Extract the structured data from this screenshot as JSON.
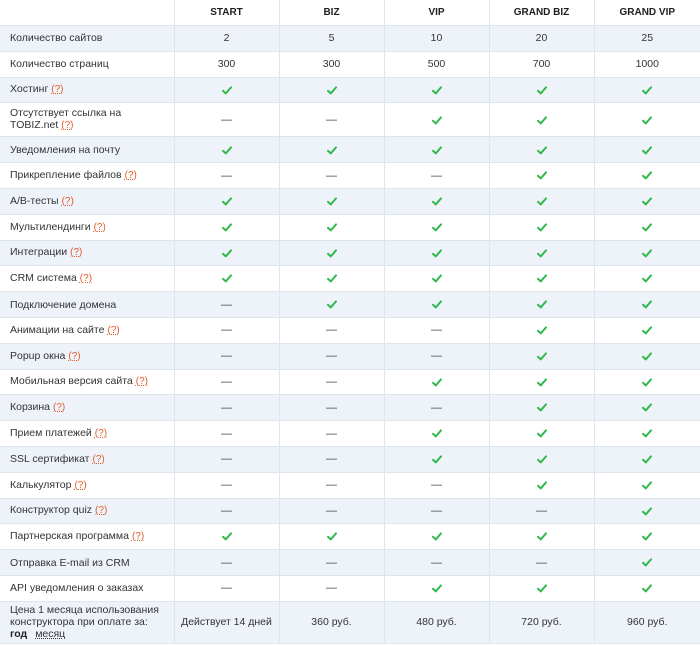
{
  "plans": [
    "START",
    "BIZ",
    "VIP",
    "GRAND BIZ",
    "GRAND VIP"
  ],
  "help_mark": "(?)",
  "colors": {
    "check": "#2fb84a",
    "help": "#e25d2b",
    "row_alt": "#eef3fa",
    "border": "#dfe5ec"
  },
  "rows": [
    {
      "label": "Количество сайтов",
      "help": false,
      "type": "text",
      "values": [
        "2",
        "5",
        "10",
        "20",
        "25"
      ]
    },
    {
      "label": "Количество страниц",
      "help": false,
      "type": "text",
      "values": [
        "300",
        "300",
        "500",
        "700",
        "1000"
      ]
    },
    {
      "label": "Хостинг",
      "help": true,
      "type": "bool",
      "values": [
        true,
        true,
        true,
        true,
        true
      ]
    },
    {
      "label": "Отсутствует ссылка на TOBIZ.net",
      "help": true,
      "type": "bool",
      "tall": true,
      "values": [
        false,
        false,
        true,
        true,
        true
      ]
    },
    {
      "label": "Уведомления на почту",
      "help": false,
      "type": "bool",
      "values": [
        true,
        true,
        true,
        true,
        true
      ]
    },
    {
      "label": "Прикрепление файлов",
      "help": true,
      "type": "bool",
      "values": [
        false,
        false,
        false,
        true,
        true
      ]
    },
    {
      "label": "A/B-тесты",
      "help": true,
      "type": "bool",
      "values": [
        true,
        true,
        true,
        true,
        true
      ]
    },
    {
      "label": "Мультилендинги",
      "help": true,
      "type": "bool",
      "values": [
        true,
        true,
        true,
        true,
        true
      ]
    },
    {
      "label": "Интеграции",
      "help": true,
      "type": "bool",
      "values": [
        true,
        true,
        true,
        true,
        true
      ]
    },
    {
      "label": "CRM система",
      "help": true,
      "type": "bool",
      "values": [
        true,
        true,
        true,
        true,
        true
      ]
    },
    {
      "label": "Подключение домена",
      "help": false,
      "type": "bool",
      "values": [
        false,
        true,
        true,
        true,
        true
      ]
    },
    {
      "label": "Анимации на сайте",
      "help": true,
      "type": "bool",
      "values": [
        false,
        false,
        false,
        true,
        true
      ]
    },
    {
      "label": "Popup окна",
      "help": true,
      "type": "bool",
      "values": [
        false,
        false,
        false,
        true,
        true
      ]
    },
    {
      "label": "Мобильная версия сайта",
      "help": true,
      "type": "bool",
      "values": [
        false,
        false,
        true,
        true,
        true
      ]
    },
    {
      "label": "Корзина",
      "help": true,
      "type": "bool",
      "values": [
        false,
        false,
        false,
        true,
        true
      ]
    },
    {
      "label": "Прием платежей",
      "help": true,
      "type": "bool",
      "values": [
        false,
        false,
        true,
        true,
        true
      ]
    },
    {
      "label": "SSL сертификат",
      "help": true,
      "type": "bool",
      "values": [
        false,
        false,
        true,
        true,
        true
      ]
    },
    {
      "label": "Калькулятор",
      "help": true,
      "type": "bool",
      "values": [
        false,
        false,
        false,
        true,
        true
      ]
    },
    {
      "label": "Конструктор quiz",
      "help": true,
      "type": "bool",
      "values": [
        false,
        false,
        false,
        false,
        true
      ]
    },
    {
      "label": "Партнерская программа",
      "help": true,
      "type": "bool",
      "values": [
        true,
        true,
        true,
        true,
        true
      ]
    },
    {
      "label": "Отправка E-mail из CRM",
      "help": false,
      "type": "bool",
      "values": [
        false,
        false,
        false,
        false,
        true
      ]
    },
    {
      "label": "API уведомления о заказах",
      "help": false,
      "type": "bool",
      "values": [
        false,
        false,
        true,
        true,
        true
      ]
    }
  ],
  "price_row": {
    "label": "Цена 1 месяца использования конструктора при оплате за:",
    "period_selected": "год",
    "period_other": "месяц",
    "values": [
      "Действует 14 дней",
      "360 руб.",
      "480 руб.",
      "720 руб.",
      "960 руб."
    ]
  }
}
